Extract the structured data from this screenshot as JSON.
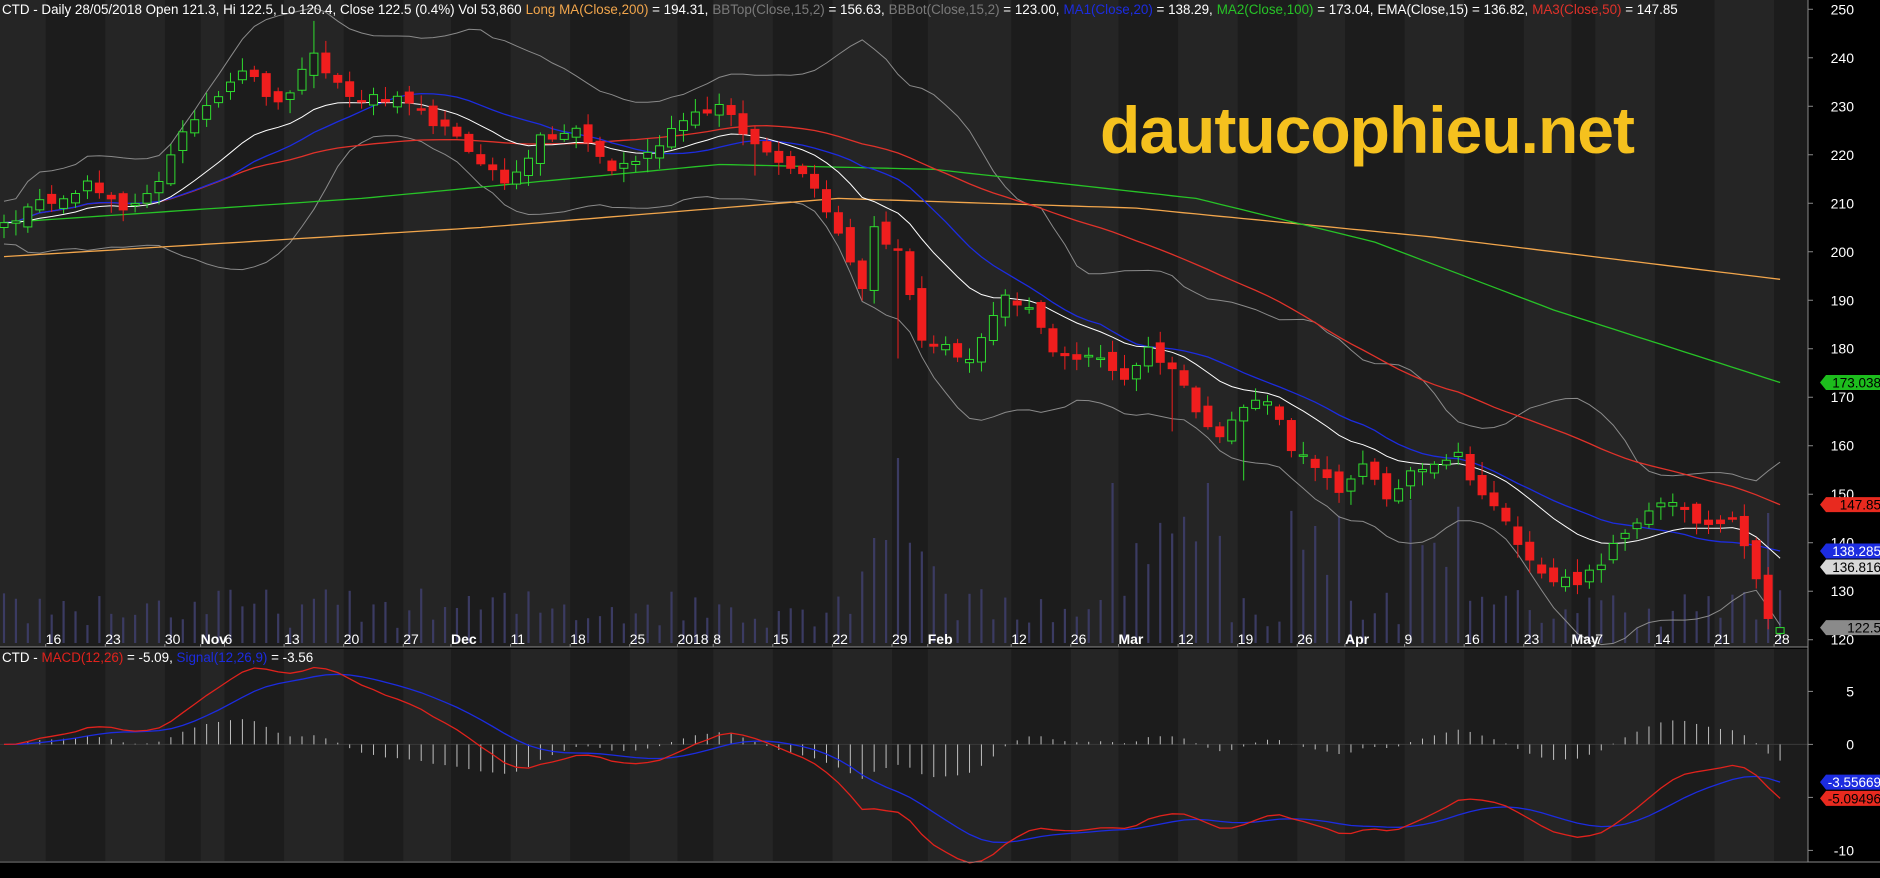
{
  "header": {
    "symbol": "CTD",
    "summary": "CTD - Daily 28/05/2018 Open 121.3, Hi 122.5, Lo 120.4, Close 122.5 (0.4%) Vol 53,860",
    "indicators": [
      {
        "name": "Long MA(Close,200)",
        "value": " = 194.31,",
        "color": "#f2a64c"
      },
      {
        "name": "BBTop(Close,15,2)",
        "value": " = 156.63,",
        "color": "#7a7a7a"
      },
      {
        "name": "BBBot(Close,15,2)",
        "value": " = 123.00,",
        "color": "#7a7a7a"
      },
      {
        "name": "MA1(Close,20)",
        "value": " = 138.29,",
        "color": "#1c2ce0"
      },
      {
        "name": "MA2(Close,100)",
        "value": " = 173.04,",
        "color": "#27c327"
      },
      {
        "name": "EMA(Close,15)",
        "value": " = 136.82,",
        "color": "#ffffff"
      },
      {
        "name": "MA3(Close,50)",
        "value": " = 147.85",
        "color": "#e0322a"
      }
    ]
  },
  "watermark": "dautucophieu.net",
  "macd_header": {
    "symbol": "CTD -",
    "macd_name": "MACD(12,26)",
    "macd_value": " = -5.09,",
    "signal_name": "Signal(12,26,9)",
    "signal_value": " = -3.56"
  },
  "chart_data": [
    {
      "type": "candlestick",
      "ylim": [
        118.5,
        251.5
      ],
      "yticks": [
        120,
        130,
        140,
        150,
        160,
        170,
        180,
        190,
        200,
        210,
        220,
        230,
        240,
        250
      ],
      "xtick_labels": [
        {
          "label": "16",
          "i": 4
        },
        {
          "label": "23",
          "i": 9
        },
        {
          "label": "30",
          "i": 14
        },
        {
          "label": "Nov",
          "i": 17
        },
        {
          "label": "6",
          "i": 19
        },
        {
          "label": "13",
          "i": 24
        },
        {
          "label": "20",
          "i": 29
        },
        {
          "label": "27",
          "i": 34
        },
        {
          "label": "Dec",
          "i": 38
        },
        {
          "label": "11",
          "i": 43
        },
        {
          "label": "18",
          "i": 48
        },
        {
          "label": "25",
          "i": 53
        },
        {
          "label": "2018",
          "i": 57
        },
        {
          "label": "8",
          "i": 60
        },
        {
          "label": "15",
          "i": 65
        },
        {
          "label": "22",
          "i": 70
        },
        {
          "label": "29",
          "i": 75
        },
        {
          "label": "Feb",
          "i": 78
        },
        {
          "label": "12",
          "i": 85
        },
        {
          "label": "26",
          "i": 90
        },
        {
          "label": "Mar",
          "i": 94
        },
        {
          "label": "12",
          "i": 99
        },
        {
          "label": "19",
          "i": 104
        },
        {
          "label": "26",
          "i": 109
        },
        {
          "label": "Apr",
          "i": 113
        },
        {
          "label": "9",
          "i": 118
        },
        {
          "label": "16",
          "i": 123
        },
        {
          "label": "23",
          "i": 128
        },
        {
          "label": "May",
          "i": 132
        },
        {
          "label": "7",
          "i": 134
        },
        {
          "label": "14",
          "i": 139
        },
        {
          "label": "21",
          "i": 144
        },
        {
          "label": "28",
          "i": 149
        }
      ],
      "value_tags": [
        {
          "label": "173.038",
          "value": 173.04,
          "bg": "#1dbd1d",
          "fg": "#000000"
        },
        {
          "label": "147.85",
          "value": 147.85,
          "bg": "#e82a1f",
          "fg": "#000000"
        },
        {
          "label": "138.285",
          "value": 138.29,
          "bg": "#1c2ce0",
          "fg": "#ffffff"
        },
        {
          "label": "136.816",
          "value": 136.82,
          "bg": "#d8d8d8",
          "fg": "#000000"
        },
        {
          "label": "122.5",
          "value": 122.5,
          "bg": "#8a8a8a",
          "fg": "#000000"
        }
      ],
      "anchors": [
        [
          0,
          206
        ],
        [
          4,
          211
        ],
        [
          7,
          214
        ],
        [
          10,
          208
        ],
        [
          13,
          215
        ],
        [
          16,
          228
        ],
        [
          18,
          233
        ],
        [
          20,
          238
        ],
        [
          23,
          230
        ],
        [
          26,
          240
        ],
        [
          29,
          232
        ],
        [
          33,
          231
        ],
        [
          36,
          227
        ],
        [
          40,
          219
        ],
        [
          42,
          214
        ],
        [
          45,
          223
        ],
        [
          48,
          225
        ],
        [
          51,
          217
        ],
        [
          54,
          220
        ],
        [
          57,
          228
        ],
        [
          60,
          230
        ],
        [
          63,
          222
        ],
        [
          66,
          218
        ],
        [
          68,
          214
        ],
        [
          70,
          204
        ],
        [
          72,
          193
        ],
        [
          73,
          205
        ],
        [
          75,
          200
        ],
        [
          77,
          182
        ],
        [
          79,
          180
        ],
        [
          81,
          178
        ],
        [
          82,
          182
        ],
        [
          84,
          190
        ],
        [
          86,
          188
        ],
        [
          88,
          180
        ],
        [
          90,
          178
        ],
        [
          92,
          178
        ],
        [
          94,
          174
        ],
        [
          96,
          180
        ],
        [
          98,
          176
        ],
        [
          100,
          168
        ],
        [
          102,
          162
        ],
        [
          104,
          168
        ],
        [
          106,
          170
        ],
        [
          108,
          160
        ],
        [
          110,
          155
        ],
        [
          112,
          150
        ],
        [
          114,
          157
        ],
        [
          116,
          148
        ],
        [
          118,
          155
        ],
        [
          120,
          157
        ],
        [
          122,
          158
        ],
        [
          124,
          150
        ],
        [
          126,
          144
        ],
        [
          128,
          136
        ],
        [
          130,
          133
        ],
        [
          132,
          131
        ],
        [
          134,
          136
        ],
        [
          136,
          142
        ],
        [
          138,
          147
        ],
        [
          140,
          148
        ],
        [
          142,
          144
        ],
        [
          144,
          143
        ],
        [
          145,
          144
        ],
        [
          146,
          140
        ],
        [
          147,
          132
        ],
        [
          148,
          124
        ],
        [
          149,
          122.5
        ]
      ],
      "series": [
        {
          "name": "Long MA(Close,200)",
          "last": 194.31,
          "color": "#f2a64c"
        },
        {
          "name": "MA2(Close,100)",
          "last": 173.04,
          "color": "#27c327"
        },
        {
          "name": "MA3(Close,50)",
          "last": 147.85,
          "color": "#e0322a"
        },
        {
          "name": "MA1(Close,20)",
          "last": 138.29,
          "color": "#1c2ce0"
        },
        {
          "name": "EMA(Close,15)",
          "last": 136.82,
          "color": "#ffffff"
        },
        {
          "name": "BBTop(Close,15,2)",
          "last": 156.63,
          "color": "#8a8a8a"
        },
        {
          "name": "BBBot(Close,15,2)",
          "last": 123.0,
          "color": "#8a8a8a"
        }
      ],
      "last_bar": {
        "open": 121.3,
        "high": 122.5,
        "low": 120.4,
        "close": 122.5,
        "volume": 53860
      }
    },
    {
      "type": "line",
      "ylim": [
        -11,
        9
      ],
      "yticks": [
        -10,
        -5,
        0,
        5
      ],
      "series": [
        {
          "name": "MACD(12,26)",
          "last": -5.09,
          "color": "#e0221c"
        },
        {
          "name": "Signal(12,26,9)",
          "last": -3.56,
          "color": "#1c2ce0"
        }
      ],
      "value_tags": [
        {
          "label": "-3.55669",
          "value": -3.56,
          "bg": "#1c2ce0",
          "fg": "#ffffff"
        },
        {
          "label": "-5.09496",
          "value": -5.09,
          "bg": "#e82a1f",
          "fg": "#000000"
        }
      ]
    }
  ]
}
